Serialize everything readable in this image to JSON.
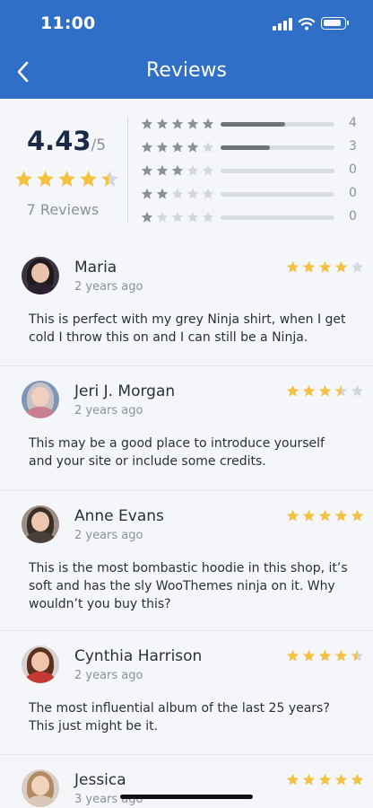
{
  "status_bar": {
    "time": "11:00"
  },
  "header": {
    "title": "Reviews",
    "back_icon": "chevron-left-icon"
  },
  "summary": {
    "average": "4.43",
    "out_of": "/5",
    "average_rating": 4.43,
    "total_label": "7 Reviews",
    "distribution": [
      {
        "stars": 5,
        "count": "4",
        "fraction": 0.57
      },
      {
        "stars": 4,
        "count": "3",
        "fraction": 0.43
      },
      {
        "stars": 3,
        "count": "0",
        "fraction": 0
      },
      {
        "stars": 2,
        "count": "0",
        "fraction": 0
      },
      {
        "stars": 1,
        "count": "0",
        "fraction": 0
      }
    ]
  },
  "reviews": [
    {
      "name": "Maria",
      "time": "2 years ago",
      "rating": 4,
      "text": "This is perfect with my grey Ninja shirt, when I get cold I throw this on and I can still be a Ninja."
    },
    {
      "name": "Jeri J. Morgan",
      "time": "2 years ago",
      "rating": 3.5,
      "text": "This may be a good place to introduce yourself and your site or include some credits."
    },
    {
      "name": "Anne Evans",
      "time": "2 years ago",
      "rating": 5,
      "text": "This is the most bombastic hoodie in this shop, it’s soft and has the sly WooThemes ninja on it. Why wouldn’t you buy this?"
    },
    {
      "name": "Cynthia Harrison",
      "time": "2 years ago",
      "rating": 4.5,
      "text": "The most influential album of the last 25 years? This just might be it."
    },
    {
      "name": "Jessica",
      "time": "3 years ago",
      "rating": 5,
      "text": ""
    }
  ],
  "colors": {
    "header": "#2f6fc7",
    "star_filled": "#f5c142",
    "star_empty": "#d3d7dd",
    "mini_star_filled": "#8d9196"
  }
}
